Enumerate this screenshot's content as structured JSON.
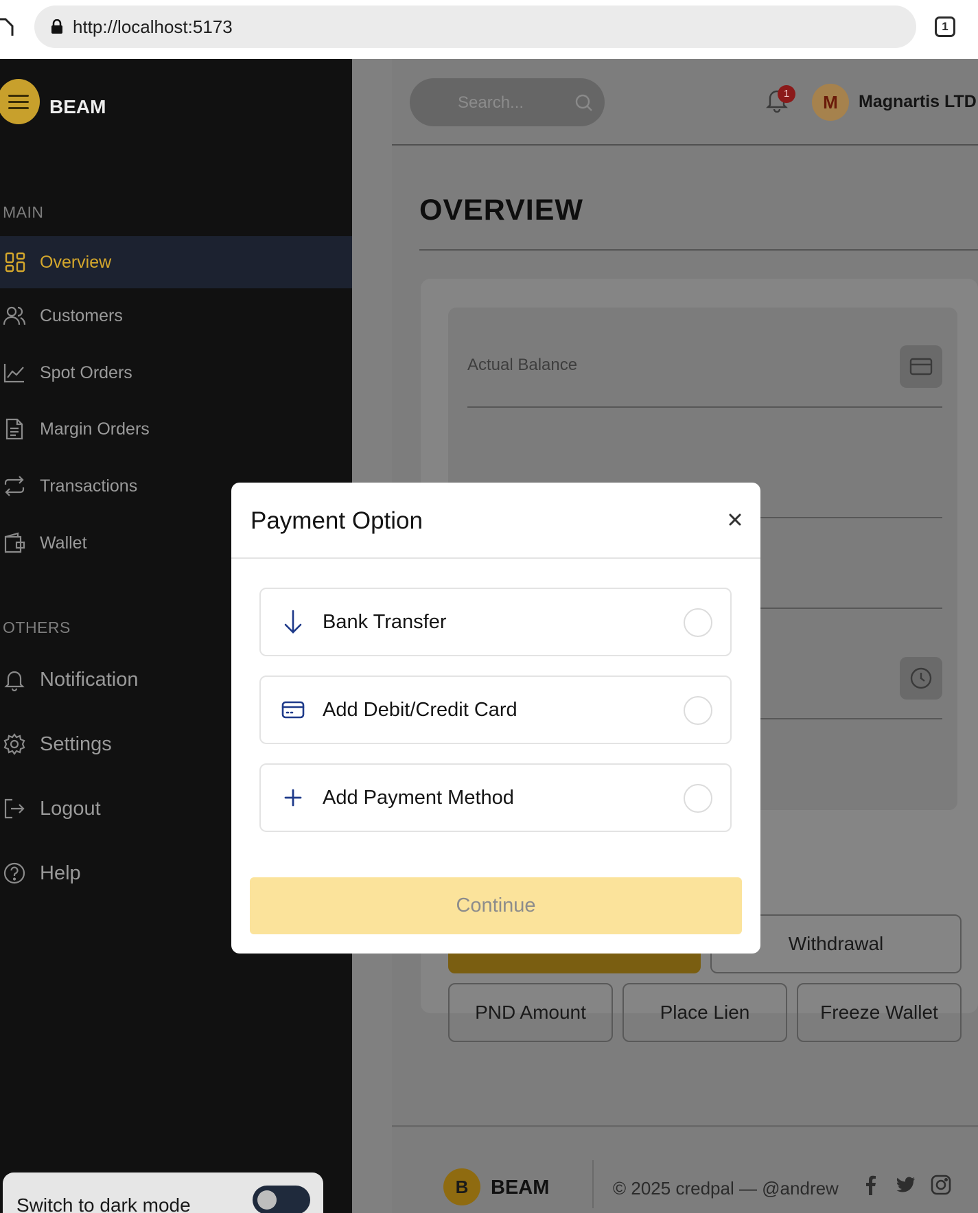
{
  "browser": {
    "url": "http://localhost:5173",
    "tab_count": "1"
  },
  "sidebar": {
    "brand": "BEAM",
    "main_label": "MAIN",
    "others_label": "OTHERS",
    "items": [
      {
        "label": "Overview",
        "icon": "grid-icon",
        "active": true
      },
      {
        "label": "Customers",
        "icon": "users-icon"
      },
      {
        "label": "Spot Orders",
        "icon": "chart-line-icon"
      },
      {
        "label": "Margin Orders",
        "icon": "document-icon"
      },
      {
        "label": "Transactions",
        "icon": "repeat-icon"
      },
      {
        "label": "Wallet",
        "icon": "wallet-icon"
      }
    ],
    "others": [
      {
        "label": "Notification",
        "icon": "bell-icon"
      },
      {
        "label": "Settings",
        "icon": "gear-icon"
      },
      {
        "label": "Logout",
        "icon": "logout-icon"
      },
      {
        "label": "Help",
        "icon": "help-icon"
      }
    ],
    "dark_mode_label": "Switch to dark mode",
    "dark_mode_on": false
  },
  "header": {
    "search_placeholder": "Search...",
    "notification_count": "1",
    "avatar_initial": "M",
    "company": "Magnartis LTD"
  },
  "main": {
    "title": "OVERVIEW",
    "balance_label": "Actual Balance",
    "buttons": {
      "withdrawal": "Withdrawal",
      "pnd": "PND Amount",
      "lien": "Place Lien",
      "freeze": "Freeze Wallet"
    }
  },
  "footer": {
    "logo_initial": "B",
    "brand": "BEAM",
    "copyright": "© 2025 credpal — @andrew"
  },
  "modal": {
    "title": "Payment Option",
    "options": [
      {
        "label": "Bank Transfer",
        "icon": "arrow-down-icon"
      },
      {
        "label": "Add Debit/Credit Card",
        "icon": "credit-card-icon"
      },
      {
        "label": "Add Payment Method",
        "icon": "plus-icon"
      }
    ],
    "continue_label": "Continue"
  },
  "colors": {
    "accent": "#d4a72c",
    "option_icon": "#1e3a8a",
    "continue_bg": "#fbe39b"
  }
}
